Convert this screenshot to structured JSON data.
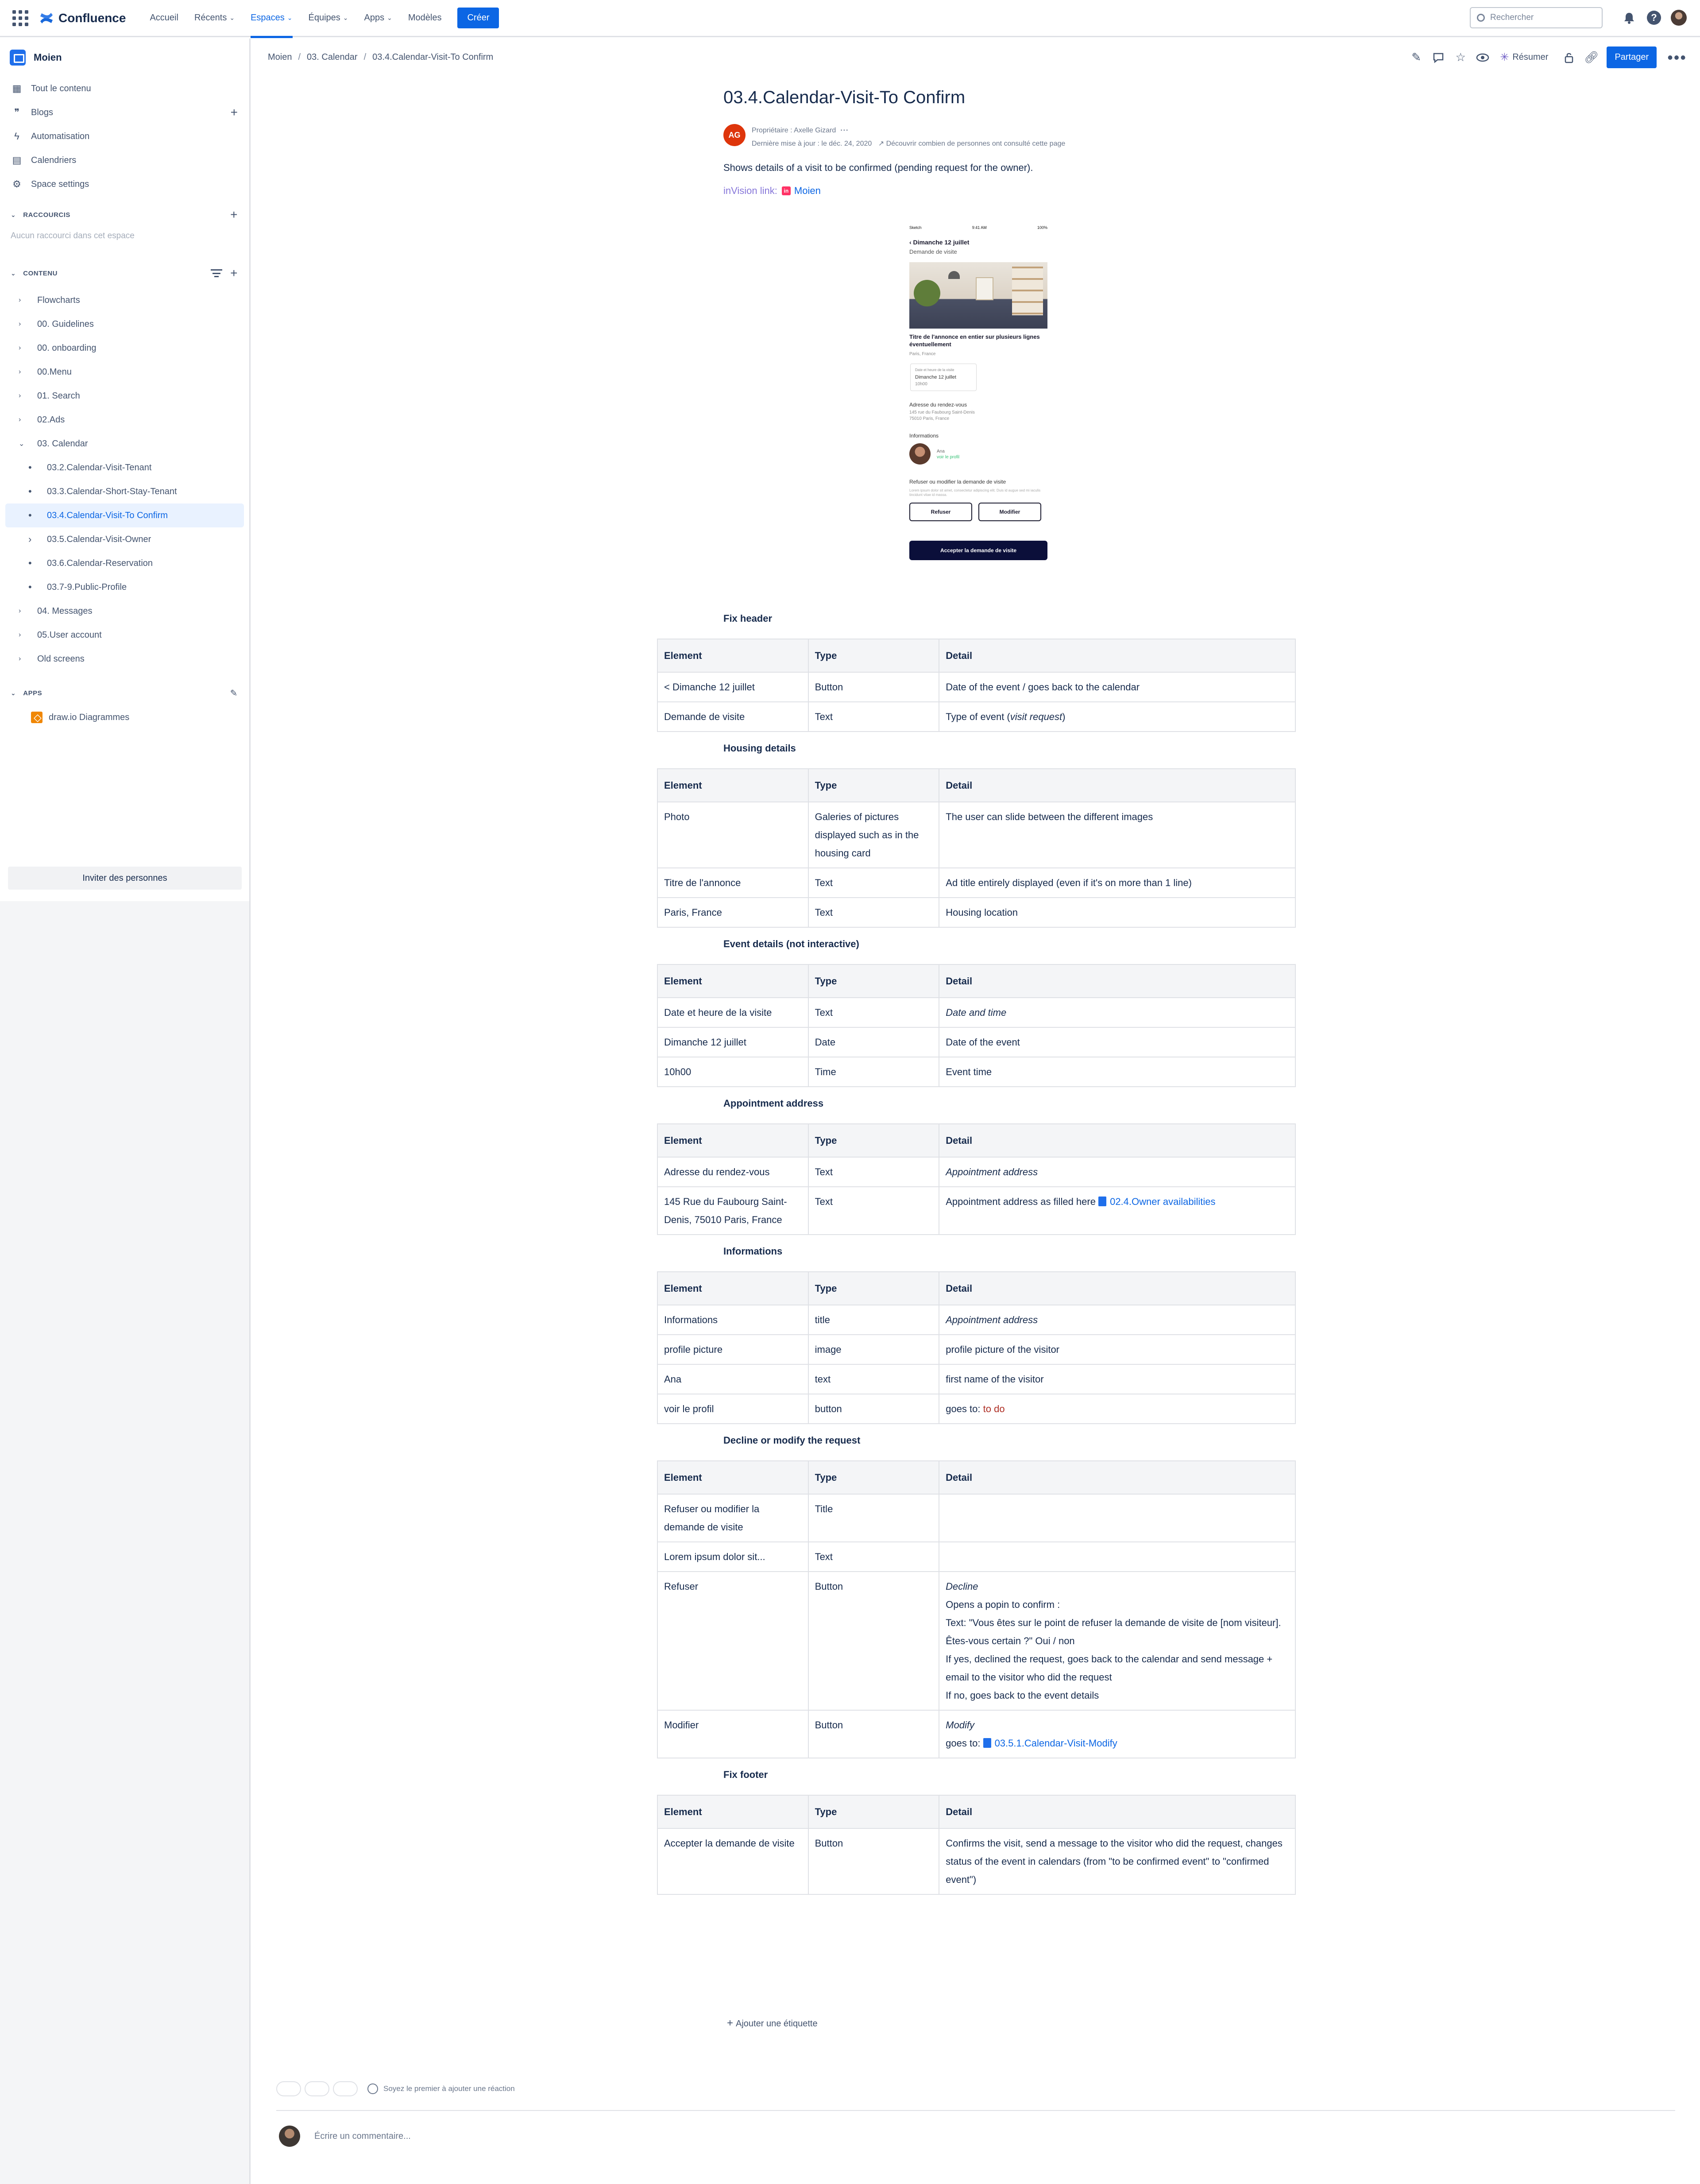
{
  "topnav": {
    "logo_text": "Confluence",
    "items": [
      {
        "label": "Accueil",
        "dropdown": false,
        "active": false
      },
      {
        "label": "Récents",
        "dropdown": true,
        "active": false
      },
      {
        "label": "Espaces",
        "dropdown": true,
        "active": true
      },
      {
        "label": "Équipes",
        "dropdown": true,
        "active": false
      },
      {
        "label": "Apps",
        "dropdown": true,
        "active": false
      },
      {
        "label": "Modèles",
        "dropdown": false,
        "active": false
      }
    ],
    "create_label": "Créer",
    "search_placeholder": "Rechercher",
    "accent_color": "#0c66e4"
  },
  "sidebar": {
    "space_name": "Moien",
    "links": [
      {
        "label": "Tout le contenu",
        "icon": "content-grid-icon",
        "plus": false
      },
      {
        "label": "Blogs",
        "icon": "quote-icon",
        "plus": true
      },
      {
        "label": "Automatisation",
        "icon": "lightning-icon",
        "plus": false
      },
      {
        "label": "Calendriers",
        "icon": "calendar-icon",
        "plus": false
      },
      {
        "label": "Space settings",
        "icon": "gear-icon",
        "plus": false
      }
    ],
    "shortcuts_title": "RACCOURCIS",
    "shortcuts_empty": "Aucun raccourci dans cet espace",
    "content_title": "CONTENU",
    "tree": [
      {
        "label": "Flowcharts",
        "level": 0,
        "expanded": false,
        "selected": false
      },
      {
        "label": "00. Guidelines",
        "level": 0,
        "expanded": false,
        "selected": false
      },
      {
        "label": "00. onboarding",
        "level": 0,
        "expanded": false,
        "selected": false
      },
      {
        "label": "00.Menu",
        "level": 0,
        "expanded": false,
        "selected": false
      },
      {
        "label": "01. Search",
        "level": 0,
        "expanded": false,
        "selected": false
      },
      {
        "label": "02.Ads",
        "level": 0,
        "expanded": false,
        "selected": false
      },
      {
        "label": "03. Calendar",
        "level": 0,
        "expanded": true,
        "selected": false
      },
      {
        "label": "03.2.Calendar-Visit-Tenant",
        "level": 1,
        "expanded": false,
        "selected": false
      },
      {
        "label": "03.3.Calendar-Short-Stay-Tenant",
        "level": 1,
        "expanded": false,
        "selected": false
      },
      {
        "label": "03.4.Calendar-Visit-To Confirm",
        "level": 1,
        "expanded": false,
        "selected": true
      },
      {
        "label": "03.5.Calendar-Visit-Owner",
        "level": 1,
        "expanded": false,
        "selected": false,
        "has_children": true
      },
      {
        "label": "03.6.Calendar-Reservation",
        "level": 1,
        "expanded": false,
        "selected": false
      },
      {
        "label": "03.7-9.Public-Profile",
        "level": 1,
        "expanded": false,
        "selected": false
      },
      {
        "label": "04. Messages",
        "level": 0,
        "expanded": false,
        "selected": false
      },
      {
        "label": "05.User account",
        "level": 0,
        "expanded": false,
        "selected": false
      },
      {
        "label": "Old screens",
        "level": 0,
        "expanded": false,
        "selected": false
      }
    ],
    "apps_title": "APPS",
    "apps": [
      {
        "label": "draw.io Diagrammes",
        "icon": "drawio-icon"
      }
    ],
    "invite_label": "Inviter des personnes"
  },
  "breadcrumb": [
    "Moien",
    "03. Calendar",
    "03.4.Calendar-Visit-To Confirm"
  ],
  "page_actions": {
    "resume_label": "Résumer",
    "share_label": "Partager"
  },
  "page": {
    "title": "03.4.Calendar-Visit-To Confirm",
    "author_initials": "AG",
    "owner_line": "Propriétaire : Axelle Gizard",
    "updated_line": "Dernière mise à jour : le déc. 24, 2020",
    "views_line": "Découvrir combien de personnes ont consulté cette page",
    "intro": "Shows details of a visit to be confirmed (pending request for the owner).",
    "invision_label": "inVision link:",
    "invision_link": "Moien"
  },
  "phone": {
    "carrier": "Sketch",
    "time": "9:41 AM",
    "battery": "100%",
    "header": "‹  Dimanche 12 juillet",
    "subheader": "Demande de visite",
    "listing_title": "Titre de l'annonce en entier sur plusieurs lignes éventuellement",
    "location": "Paris, France",
    "card_label": "Date et heure de la visite",
    "card_date": "Dimanche 12 juillet",
    "card_time": "10h00",
    "address_label": "Adresse du rendez-vous",
    "address_line1": "145 rue du Faubourg Saint-Denis",
    "address_line2": "75010 Paris, France",
    "info_label": "Informations",
    "user_name": "Ana",
    "user_link": "voir le profil",
    "decline_label": "Refuser ou modifier la demande de visite",
    "lorem": "Lorem ipsum dolor sit amet, consectetur adipiscing elit. Duis id augue sed mi iaculis tincidunt vitae id massa.",
    "btn_decline": "Refuser",
    "btn_modify": "Modifier",
    "btn_accept": "Accepter la demande de visite"
  },
  "table_headers": {
    "element": "Element",
    "type": "Type",
    "detail": "Detail"
  },
  "sections": [
    {
      "title": "Fix header",
      "rows": [
        {
          "element": "< Dimanche 12 juillet",
          "type": "Button",
          "detail": "Date of the event / goes back to the calendar"
        },
        {
          "element": "Demande de visite",
          "type": "Text",
          "detail_prefix": "Type of event (",
          "detail_italic": "visit request",
          "detail_suffix": ")"
        }
      ]
    },
    {
      "title": "Housing details",
      "rows": [
        {
          "element": "Photo",
          "type": "Galeries of pictures displayed such as in the housing card",
          "detail": "The user can slide between the different images"
        },
        {
          "element": "Titre de l'annonce",
          "type": "Text",
          "detail": "Ad title entirely displayed (even if it's on more than 1 line)"
        },
        {
          "element": "Paris, France",
          "type": "Text",
          "detail": "Housing location"
        }
      ]
    },
    {
      "title": "Event details (not interactive)",
      "rows": [
        {
          "element": "Date et heure de la visite",
          "type": "Text",
          "detail_italic": "Date and time"
        },
        {
          "element": "Dimanche 12 juillet",
          "type": "Date",
          "detail": "Date of the event"
        },
        {
          "element": "10h00",
          "type": "Time",
          "detail": "Event time"
        }
      ]
    },
    {
      "title": "Appointment address",
      "rows": [
        {
          "element": "Adresse du rendez-vous",
          "type": "Text",
          "detail_italic": "Appointment address"
        },
        {
          "element": "145 Rue du Faubourg Saint-Denis, 75010 Paris, France",
          "type": "Text",
          "detail": "Appointment address as filled here",
          "detail_link": "02.4.Owner availabilities"
        }
      ]
    },
    {
      "title": "Informations",
      "rows": [
        {
          "element": "Informations",
          "type": "title",
          "detail_italic": "Appointment address"
        },
        {
          "element": "profile picture",
          "type": "image",
          "detail": "profile picture of the visitor"
        },
        {
          "element": "Ana",
          "type": "text",
          "detail": "first name of the visitor"
        },
        {
          "element": "voir le profil",
          "type": "button",
          "detail": "goes to:",
          "detail_red": "to do"
        }
      ]
    },
    {
      "title": "Decline or modify the request",
      "rows": [
        {
          "element": "Refuser ou modifier la demande de visite",
          "type": "Title",
          "detail": ""
        },
        {
          "element": "Lorem ipsum dolor sit...",
          "type": "Text",
          "detail": ""
        },
        {
          "element": "Refuser",
          "type": "Button",
          "detail_italic": "Decline",
          "detail_lines": [
            "Opens a popin to confirm :",
            "Text: \"Vous êtes sur le point de refuser la demande de visite de [nom visiteur]. Êtes-vous certain ?\" Oui / non",
            "If yes, declined the request, goes back to the calendar and send message + email to the visitor who did the request",
            "If no, goes back to the event details"
          ]
        },
        {
          "element": "Modifier",
          "type": "Button",
          "detail_italic": "Modify",
          "detail": "goes to:",
          "detail_link": "03.5.1.Calendar-Visit-Modify"
        }
      ]
    },
    {
      "title": "Fix footer",
      "rows": [
        {
          "element": "Accepter la demande de visite",
          "type": "Button",
          "detail": "Confirms the visit, send a message to the visitor who did the request, changes status of the event in calendars (from \"to be confirmed event\" to \"confirmed event\")"
        }
      ]
    }
  ],
  "footer": {
    "add_label": "Ajouter une étiquette",
    "reaction_text": "Soyez le premier à ajouter une réaction",
    "comment_placeholder": "Écrire un commentaire..."
  }
}
